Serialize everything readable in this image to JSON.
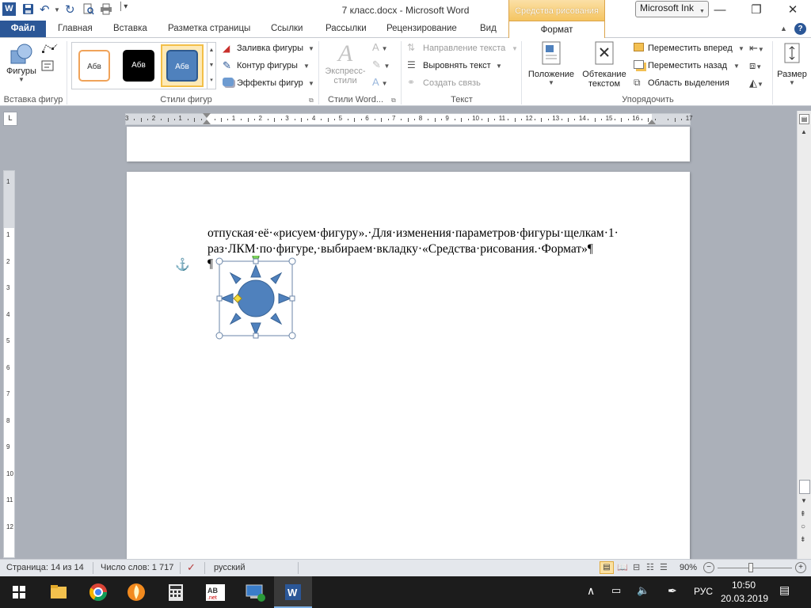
{
  "window": {
    "title": "7 класс.docx  -  Microsoft Word",
    "context_header": "Средства рисования",
    "ink_button": "Microsoft Ink",
    "min_glyph": "—",
    "max_glyph": "❐",
    "close_glyph": "✕"
  },
  "tabs": {
    "file": "Файл",
    "home": "Главная",
    "insert": "Вставка",
    "layout": "Разметка страницы",
    "references": "Ссылки",
    "mailings": "Рассылки",
    "review": "Рецензирование",
    "view": "Вид",
    "format": "Формат"
  },
  "ribbon": {
    "insert_shapes": {
      "shapes_label": "Фигуры",
      "group_label": "Вставка фигур"
    },
    "shape_styles": {
      "style1": "Абв",
      "style2": "Абв",
      "style3": "Абв",
      "fill": "Заливка фигуры",
      "outline": "Контур фигуры",
      "effects": "Эффекты фигур",
      "group_label": "Стили фигур"
    },
    "wordart": {
      "express_line1": "Экспресс-",
      "express_line2": "стили",
      "group_label": "Стили Word..."
    },
    "text": {
      "direction": "Направление текста",
      "align": "Выровнять текст",
      "link": "Создать связь",
      "group_label": "Текст"
    },
    "arrange": {
      "position": "Положение",
      "wrap_line1": "Обтекание",
      "wrap_line2": "текстом",
      "bring_forward": "Переместить вперед",
      "send_backward": "Переместить назад",
      "selection_pane": "Область выделения",
      "group_label": "Упорядочить"
    },
    "size": {
      "label": "Размер"
    }
  },
  "ruler": {
    "corner_glyph": "L",
    "marks": [
      "3",
      "2",
      "1",
      "",
      "1",
      "2",
      "3",
      "4",
      "5",
      "6",
      "7",
      "8",
      "9",
      "10",
      "11",
      "12",
      "13",
      "14",
      "15",
      "16",
      "",
      "17"
    ],
    "vmarks": [
      "1",
      "",
      "1",
      "2",
      "3",
      "4",
      "5",
      "6",
      "7",
      "8",
      "9",
      "10",
      "11",
      "12"
    ]
  },
  "document": {
    "line1": "отпуская·её·«рисуем·фигуру».·Для·изменения·параметров·фигуры·щелкам·1·",
    "line2": "раз·ЛКМ·по·фигуре,·выбираем·вкладку·«Средства·рисования.·Формат»¶",
    "line3": "¶",
    "anchor_glyph": "⚓",
    "shape": "sun"
  },
  "statusbar": {
    "page": "Страница: 14 из 14",
    "words": "Число слов: 1 717",
    "language": "русский",
    "zoom": "90%"
  },
  "taskbar": {
    "language": "РУС",
    "time": "10:50",
    "date": "20.03.2019"
  },
  "colors": {
    "accent": "#2b5797",
    "shape_fill": "#4f81bd",
    "context_tab": "#f4c25c"
  }
}
